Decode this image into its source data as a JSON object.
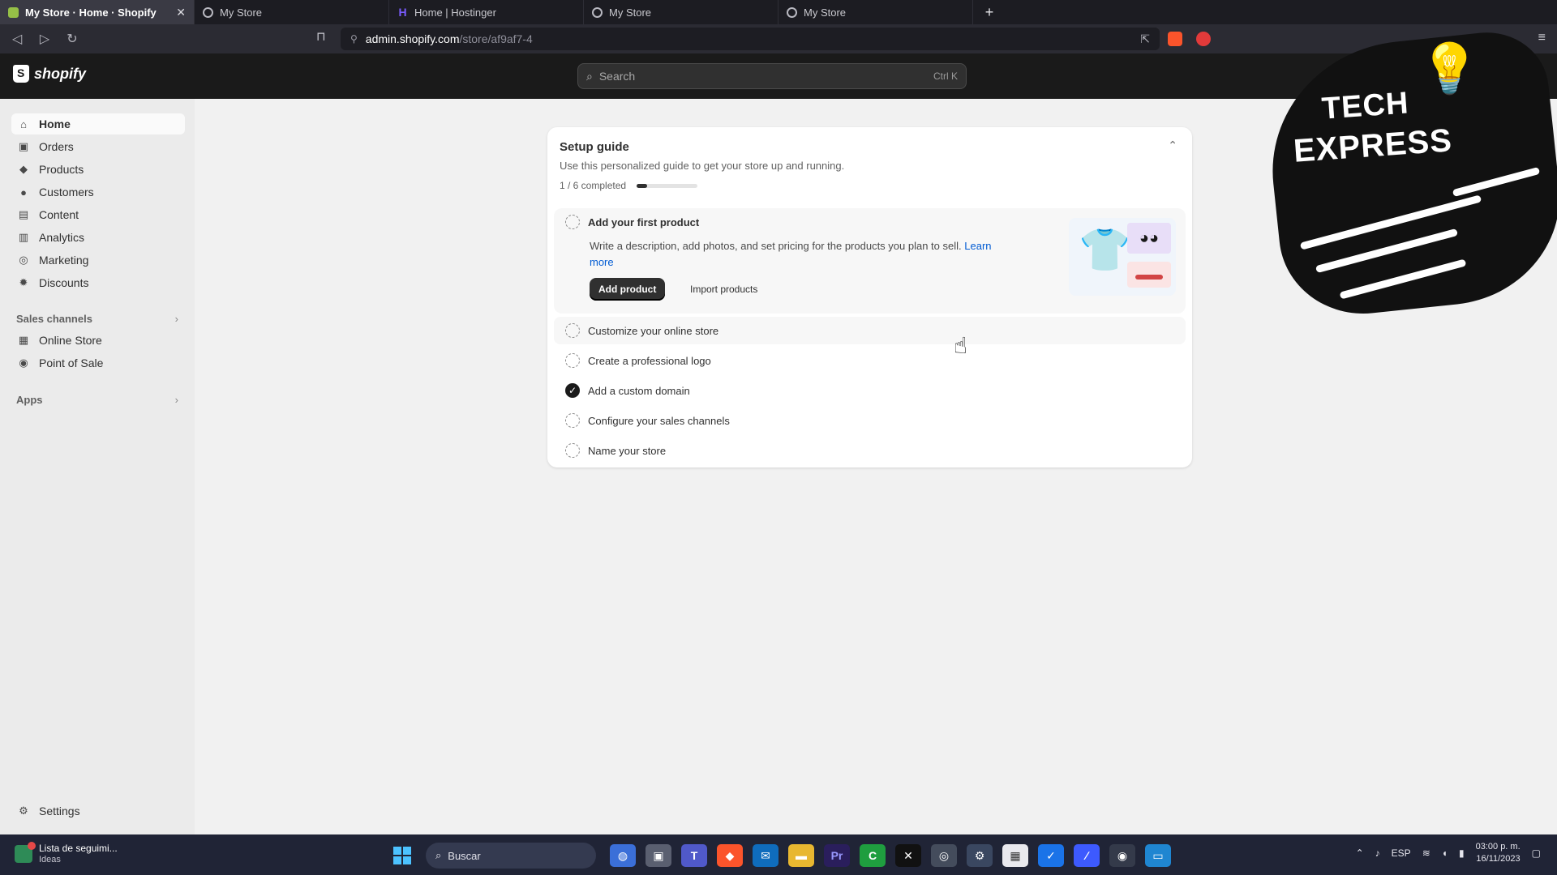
{
  "browser": {
    "tabs": [
      {
        "label": "My Store · Home · Shopify",
        "active": true,
        "favicon": "shopify-icon"
      },
      {
        "label": "My Store",
        "active": false,
        "favicon": "globe-icon"
      },
      {
        "label": "Home | Hostinger",
        "active": false,
        "favicon": "hostinger-icon"
      },
      {
        "label": "My Store",
        "active": false,
        "favicon": "globe-icon"
      },
      {
        "label": "My Store",
        "active": false,
        "favicon": "globe-icon"
      }
    ],
    "new_tab": "+",
    "url_host": "admin.shopify.com",
    "url_path": "/store/af9af7-4"
  },
  "shopify": {
    "logo_text": "shopify",
    "search_placeholder": "Search",
    "search_shortcut": "Ctrl K"
  },
  "sidebar": {
    "items": [
      {
        "label": "Home",
        "icon": "home-icon",
        "active": true
      },
      {
        "label": "Orders",
        "icon": "orders-icon"
      },
      {
        "label": "Products",
        "icon": "tag-icon"
      },
      {
        "label": "Customers",
        "icon": "person-icon"
      },
      {
        "label": "Content",
        "icon": "content-icon"
      },
      {
        "label": "Analytics",
        "icon": "chart-icon"
      },
      {
        "label": "Marketing",
        "icon": "target-icon"
      },
      {
        "label": "Discounts",
        "icon": "discount-icon"
      }
    ],
    "sales_channels_label": "Sales channels",
    "channels": [
      {
        "label": "Online Store",
        "icon": "store-icon"
      },
      {
        "label": "Point of Sale",
        "icon": "pos-icon"
      }
    ],
    "apps_label": "Apps",
    "settings_label": "Settings"
  },
  "setup": {
    "title": "Setup guide",
    "subtitle": "Use this personalized guide to get your store up and running.",
    "progress_text": "1 / 6 completed",
    "progress_fraction": 0.1667,
    "first_task": {
      "title": "Add your first product",
      "description": "Write a description, add photos, and set pricing for the products you plan to sell.",
      "learn_more": "Learn more",
      "primary_button": "Add product",
      "secondary_button": "Import products"
    },
    "tasks": [
      {
        "label": "Customize your online store",
        "done": false
      },
      {
        "label": "Create a professional logo",
        "done": false
      },
      {
        "label": "Add a custom domain",
        "done": true
      },
      {
        "label": "Configure your sales channels",
        "done": false
      },
      {
        "label": "Name your store",
        "done": false
      }
    ]
  },
  "overlay": {
    "line1": "TECH",
    "line2": "EXPRESS"
  },
  "taskbar": {
    "news_title": "Lista de seguimi...",
    "news_sub": "Ideas",
    "search_label": "Buscar",
    "language": "ESP",
    "time": "03:00 p. m.",
    "date": "16/11/2023"
  },
  "colors": {
    "accent_link": "#005bd3",
    "topbar": "#1a1a1a",
    "primary_button": "#303030"
  }
}
